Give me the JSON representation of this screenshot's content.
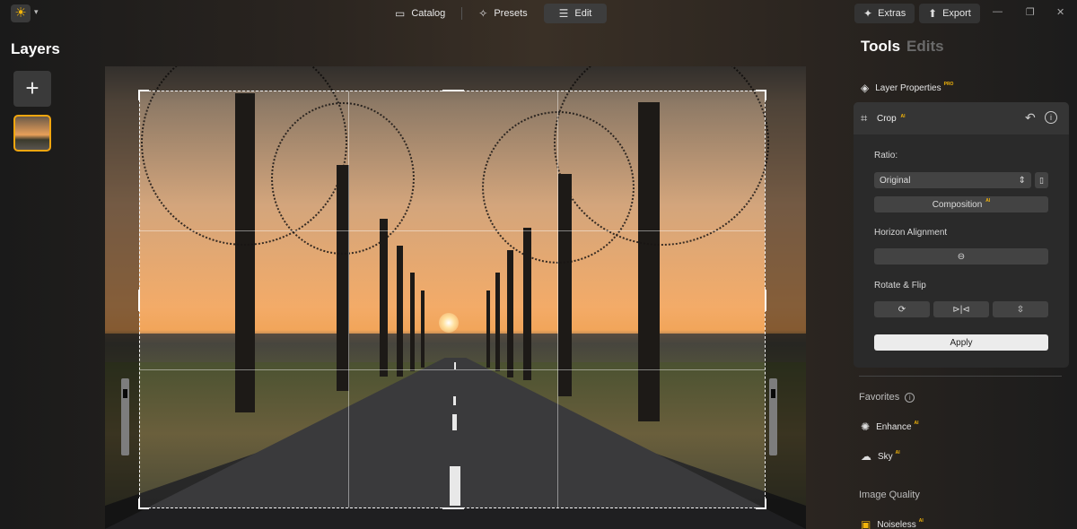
{
  "topbar": {
    "logo_icon": "sun-logo",
    "nav": [
      {
        "label": "Catalog",
        "icon": "folder-icon"
      },
      {
        "label": "Presets",
        "icon": "sparkle-icon"
      },
      {
        "label": "Edit",
        "icon": "sliders-icon",
        "active": true
      }
    ],
    "extras_label": "Extras",
    "export_label": "Export"
  },
  "layers": {
    "title": "Layers",
    "add_label": "+"
  },
  "right_panel": {
    "tabs": {
      "tools": "Tools",
      "edits": "Edits"
    },
    "layer_properties": {
      "label": "Layer Properties",
      "badge": "PRO"
    },
    "crop": {
      "title": "Crop",
      "badge": "AI",
      "ratio_label": "Ratio:",
      "ratio_value": "Original",
      "composition_label": "Composition",
      "composition_badge": "AI",
      "horizon_label": "Horizon Alignment",
      "rotate_label": "Rotate & Flip",
      "apply_label": "Apply"
    },
    "favorites": {
      "title": "Favorites",
      "items": [
        {
          "label": "Enhance",
          "badge": "AI",
          "icon": "sparkle-burst-icon"
        },
        {
          "label": "Sky",
          "badge": "AI",
          "icon": "cloud-icon"
        }
      ]
    },
    "image_quality": {
      "title": "Image Quality",
      "items": [
        {
          "label": "Noiseless",
          "badge": "AI",
          "icon": "noiseless-icon"
        }
      ]
    }
  },
  "colors": {
    "accent": "#f2a60f",
    "badge": "#f2b40a",
    "panel": "#2a2a2a",
    "panel_header": "#353535"
  }
}
